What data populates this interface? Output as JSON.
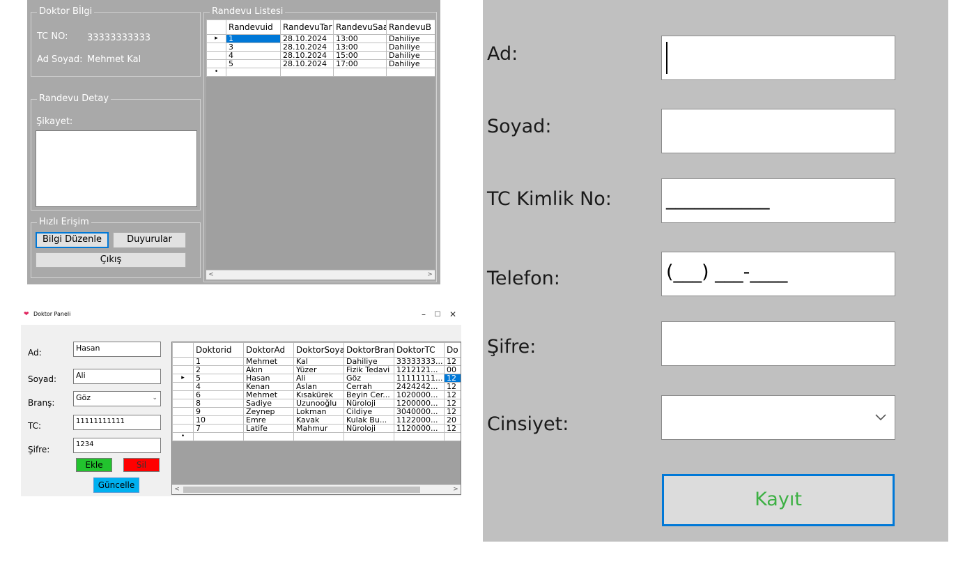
{
  "doctor_detail": {
    "info_group_title": "Doktor Bİlgi",
    "tc_label": "TC NO:",
    "tc_value": "33333333333",
    "name_label": "Ad Soyad:",
    "name_value": "Mehmet Kal",
    "appointment_group_title": "Randevu Listesi",
    "detail_group_title": "Randevu Detay",
    "complaint_label": "Şikayet:",
    "quick_group_title": "Hızlı Erişim",
    "buttons": {
      "edit": "Bilgi Düzenle",
      "announcements": "Duyurular",
      "exit": "Çıkış"
    },
    "grid": {
      "columns": [
        "Randevuid",
        "RandevuTar",
        "RandevuSaa",
        "RandevuB"
      ],
      "rows": [
        [
          "1",
          "28.10.2024",
          "13:00",
          "Dahiliye"
        ],
        [
          "3",
          "28.10.2024",
          "13:00",
          "Dahiliye"
        ],
        [
          "4",
          "28.10.2024",
          "15:00",
          "Dahiliye"
        ],
        [
          "5",
          "28.10.2024",
          "17:00",
          "Dahiliye"
        ]
      ]
    }
  },
  "doctor_panel": {
    "window_title": "Doktor Paneli",
    "controls": {
      "minimize": "–",
      "maximize": "☐",
      "close": "✕"
    },
    "fields": {
      "ad_label": "Ad:",
      "ad_value": "Hasan",
      "soyad_label": "Soyad:",
      "soyad_value": "Ali",
      "brans_label": "Branş:",
      "brans_value": "Göz",
      "tc_label": "TC:",
      "tc_value": "11111111111",
      "sifre_label": "Şifre:",
      "sifre_value": "1234"
    },
    "buttons": {
      "add": "Ekle",
      "delete": "Sil",
      "update": "Güncelle"
    },
    "colors": {
      "add": "#22c32e",
      "delete": "#ff0000",
      "update": "#00b0f0"
    },
    "grid": {
      "columns": [
        "Doktorid",
        "DoktorAd",
        "DoktorSoya",
        "DoktorBran",
        "DoktorTC",
        "Do"
      ],
      "rows": [
        [
          "1",
          "Mehmet",
          "Kal",
          "Dahiliye",
          "33333333...",
          "12"
        ],
        [
          "2",
          "Akın",
          "Yüzer",
          "Fizik Tedavi",
          "1212121...",
          "00"
        ],
        [
          "5",
          "Hasan",
          "Ali",
          "Göz",
          "11111111...",
          "12"
        ],
        [
          "4",
          "Kenan",
          "Aslan",
          "Cerrah",
          "2424242...",
          "12"
        ],
        [
          "6",
          "Mehmet",
          "Kısakürek",
          "Beyin Cer...",
          "1020000...",
          "12"
        ],
        [
          "8",
          "Sadiye",
          "Uzunooğlu",
          "Nüroloji",
          "1200000...",
          "12"
        ],
        [
          "9",
          "Zeynep",
          "Lokman",
          "Cildiye",
          "3040000...",
          "12"
        ],
        [
          "10",
          "Emre",
          "Kavak",
          "Kulak Bu...",
          "1122000...",
          "20"
        ],
        [
          "7",
          "Latife",
          "Mahmur",
          "Nüroloji",
          "1120000...",
          "12"
        ]
      ]
    }
  },
  "registration": {
    "ad_label": "Ad:",
    "soyad_label": "Soyad:",
    "tc_label": "TC Kimlik No:",
    "tc_mask": "___________",
    "telefon_label": "Telefon:",
    "telefon_mask": "(___) ___-____",
    "sifre_label": "Şifre:",
    "cinsiyet_label": "Cinsiyet:",
    "submit": "Kayıt",
    "colors": {
      "submit_text": "#3cb043",
      "focus_border": "#0078d7"
    }
  }
}
